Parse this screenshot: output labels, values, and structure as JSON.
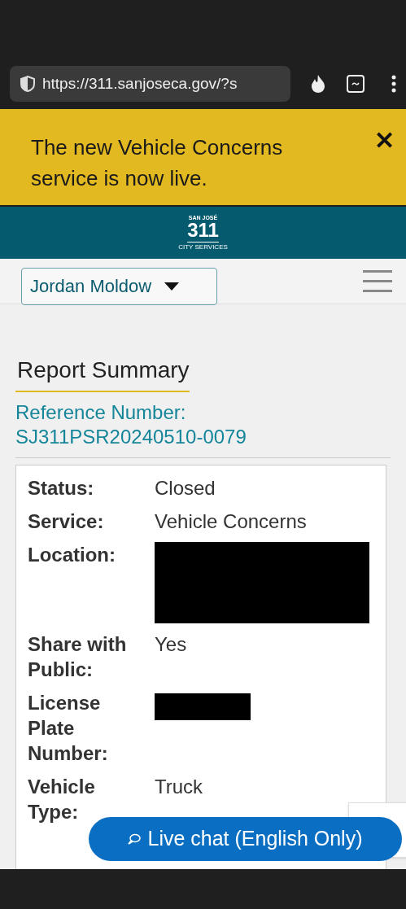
{
  "browser": {
    "url": "https://311.sanjoseca.gov/?s"
  },
  "banner": {
    "message": "The new Vehicle Concerns service is now live.",
    "close": "✕"
  },
  "logo": {
    "top": "SAN JOSÉ",
    "main": "311",
    "bottom": "CITY SERVICES"
  },
  "user_menu": {
    "label": "Jordan Moldow"
  },
  "report": {
    "title": "Report Summary",
    "reference_label": "Reference Number:",
    "reference_number": "SJ311PSR20240510-0079",
    "fields": [
      {
        "label": "Status:",
        "kind": "text",
        "value": "Closed"
      },
      {
        "label": "Service:",
        "kind": "text",
        "value": "Vehicle Concerns"
      },
      {
        "label": "Location:",
        "kind": "redacted_block"
      },
      {
        "label": "Share with Public:",
        "kind": "text",
        "value": "Yes"
      },
      {
        "label": "License Plate Number:",
        "kind": "redacted_line"
      },
      {
        "label": "Vehicle Type:",
        "kind": "text",
        "value": "Truck"
      }
    ]
  },
  "chat_button": {
    "label": "Live chat (English Only)"
  }
}
